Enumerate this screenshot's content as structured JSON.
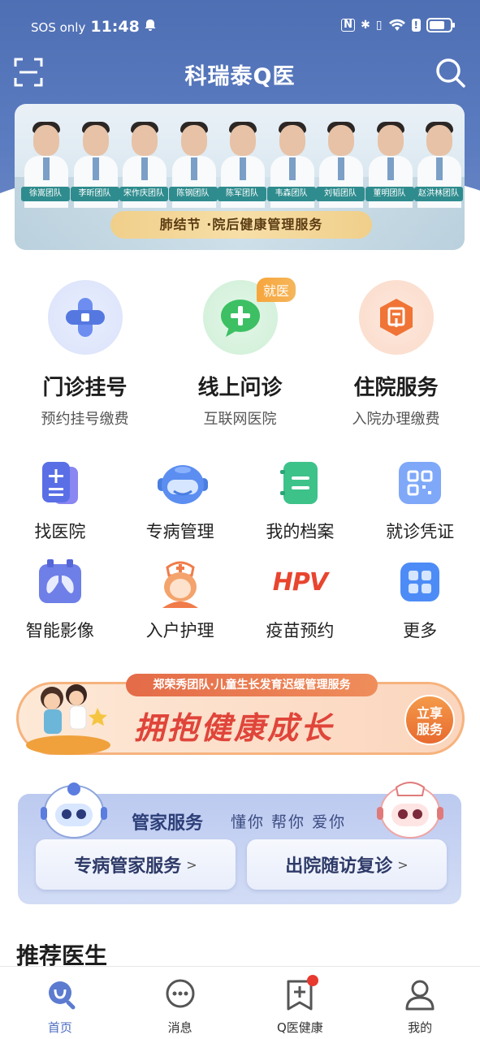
{
  "status_bar": {
    "carrier": "SOS only",
    "time": "11:48",
    "icons": [
      "bell-icon",
      "nfc-icon",
      "bluetooth-icon",
      "vibrate-icon",
      "wifi-icon",
      "alert-icon",
      "battery-icon"
    ]
  },
  "header": {
    "title": "科瑞泰Q医",
    "left_icon": "scan-icon",
    "right_icon": "search-icon"
  },
  "banner": {
    "teams": [
      "徐嵩团队",
      "李昕团队",
      "宋作庆团队",
      "陈钢团队",
      "陈军团队",
      "韦森团队",
      "刘韬团队",
      "董明团队",
      "赵洪林团队"
    ],
    "pill_text": "肺结节 ·院后健康管理服务"
  },
  "primary_services": [
    {
      "title": "门诊挂号",
      "subtitle": "预约挂号缴费",
      "icon": "cross-icon",
      "color": "#5b7de0"
    },
    {
      "title": "线上问诊",
      "subtitle": "互联网医院",
      "icon": "chat-plus-icon",
      "color": "#33b85a",
      "badge": "就医"
    },
    {
      "title": "住院服务",
      "subtitle": "入院办理缴费",
      "icon": "hospital-doc-icon",
      "color": "#f0763a"
    }
  ],
  "grid_services": [
    {
      "label": "找医院",
      "icon": "hospital-list-icon"
    },
    {
      "label": "专病管理",
      "icon": "robot-headset-icon"
    },
    {
      "label": "我的档案",
      "icon": "archive-icon"
    },
    {
      "label": "就诊凭证",
      "icon": "qr-card-icon"
    },
    {
      "label": "智能影像",
      "icon": "lungs-icon"
    },
    {
      "label": "入户护理",
      "icon": "nurse-icon"
    },
    {
      "label": "疫苗预约",
      "icon": "hpv-icon"
    },
    {
      "label": "更多",
      "icon": "grid-more-icon"
    }
  ],
  "hpv_text": "HPV",
  "promo": {
    "top_text": "郑荣秀团队·儿童生长发育迟缓管理服务",
    "slogan": "拥抱健康成长",
    "button": "立享服务",
    "button_lines": [
      "立享",
      "服务"
    ]
  },
  "steward": {
    "title": "管家服务",
    "slogan": "懂你 帮你 爱你",
    "buttons": [
      "专病管家服务",
      "出院随访复诊"
    ],
    "chevron": ">"
  },
  "section_title": "推荐医生",
  "bottom_nav": [
    {
      "label": "首页",
      "icon": "home-stethoscope-icon",
      "active": true
    },
    {
      "label": "消息",
      "icon": "message-icon",
      "active": false
    },
    {
      "label": "Q医健康",
      "icon": "health-bookmark-icon",
      "active": false,
      "dot": true
    },
    {
      "label": "我的",
      "icon": "profile-icon",
      "active": false
    }
  ]
}
